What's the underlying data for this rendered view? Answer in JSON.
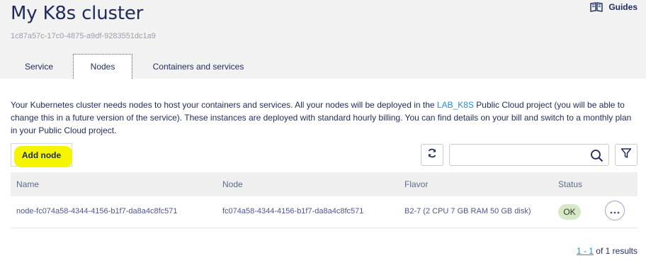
{
  "header": {
    "title": "My K8s cluster",
    "cluster_id": "1c87a57c-17c0-4875-a9df-9283551dc1a9",
    "guides_label": "Guides"
  },
  "tabs": [
    {
      "label": "Service",
      "active": false
    },
    {
      "label": "Nodes",
      "active": true
    },
    {
      "label": "Containers and services",
      "active": false
    }
  ],
  "description": {
    "before_link": "Your Kubernetes cluster needs nodes to host your containers and services. All your nodes will be deployed in the ",
    "link_text": "LAB_K8S",
    "after_link": " Public Cloud project (you will be able to change this in a future version of the service). These instances are deployed with standard hourly billing. You can find details on your bill and switch to a monthly plan in your Public Cloud project."
  },
  "toolbar": {
    "add_node_label": "Add node",
    "search_value": ""
  },
  "table": {
    "columns": [
      "Name",
      "Node",
      "Flavor",
      "Status"
    ],
    "rows": [
      {
        "name": "node-fc074a58-4344-4156-b1f7-da8a4c8fc571",
        "node": "fc074a58-4344-4156-b1f7-da8a4c8fc571",
        "flavor": "B2-7 (2 CPU 7 GB RAM 50 GB disk)",
        "status": "OK"
      }
    ]
  },
  "pagination": {
    "range": "1 - 1",
    "suffix": " of 1 results"
  },
  "colors": {
    "header_bg": "#f2f2f2",
    "title": "#1f2b5c",
    "link": "#1e8ee0",
    "highlight": "#f5f500",
    "status_ok_bg": "#d6e8c8"
  }
}
